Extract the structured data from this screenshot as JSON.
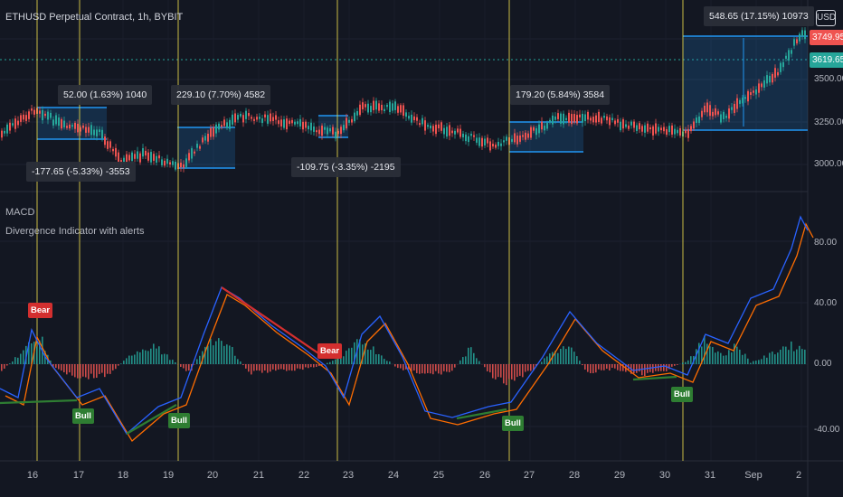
{
  "header": {
    "symbol_title": "ETHUSD Perpetual Contract, 1h, BYBIT",
    "currency": "USD"
  },
  "panes": {
    "macd_label": "MACD",
    "indicator_label": "Divergence Indicator with alerts"
  },
  "price_axis": {
    "ticks": [
      "3500.00",
      "3250.00",
      "3000.00"
    ],
    "last_price_tag": "3749.95",
    "last_price_color": "#ef5350",
    "level_tag": "3619.65",
    "level_color": "#26a69a"
  },
  "macd_axis": {
    "ticks": [
      "80.00",
      "40.00",
      "0.00",
      "-40.00"
    ]
  },
  "time_axis": {
    "ticks": [
      "16",
      "17",
      "18",
      "19",
      "20",
      "21",
      "22",
      "23",
      "24",
      "25",
      "26",
      "27",
      "28",
      "29",
      "30",
      "31",
      "Sep",
      "2"
    ]
  },
  "measure_annotations": [
    "52.00 (1.63%) 1040",
    "-177.65 (-5.33%) -3553",
    "229.10 (7.70%) 4582",
    "-109.75 (-3.35%) -2195",
    "179.20 (5.84%) 3584",
    "548.65 (17.15%) 10973"
  ],
  "signals": [
    {
      "label": "Bear",
      "kind": "bear"
    },
    {
      "label": "Bull",
      "kind": "bull"
    },
    {
      "label": "Bull",
      "kind": "bull"
    },
    {
      "label": "Bear",
      "kind": "bear"
    },
    {
      "label": "Bull",
      "kind": "bull"
    },
    {
      "label": "Bull",
      "kind": "bull"
    }
  ],
  "colors": {
    "background": "#131722",
    "macd_line": "#2962ff",
    "signal_line": "#ff6d00",
    "hist_up": "#26a69a",
    "hist_down": "#ef5350",
    "vertical_marker": "#e8d84a",
    "measure_box": "#2196f3",
    "bull_divergence": "#2e7d32",
    "bear_divergence": "#d32f2f"
  }
}
